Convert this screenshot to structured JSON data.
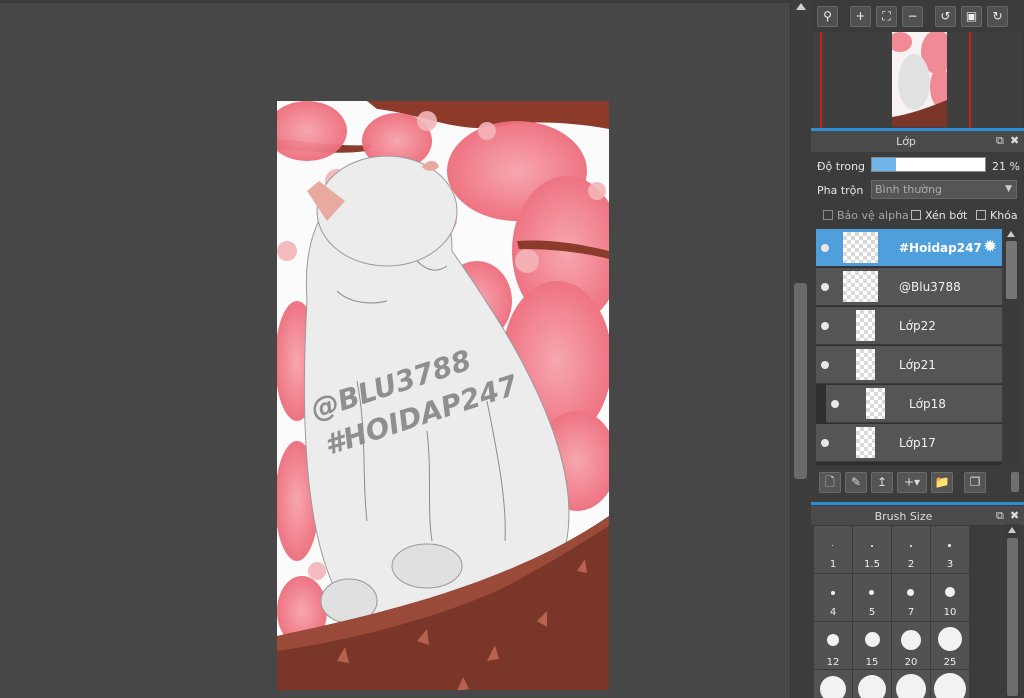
{
  "canvas": {
    "watermark_line1": "@BLU3788",
    "watermark_line2": "#HOIDAP247"
  },
  "navigator": {
    "toolbar_icons": [
      "zoom-icon",
      "zoom-in-icon",
      "fit-icon",
      "zoom-out-icon",
      "rotate-left-icon",
      "fullscreen-icon",
      "rotate-right-icon"
    ]
  },
  "layer_panel": {
    "title": "Lớp",
    "opacity_label": "Độ trong",
    "opacity_value": "21 %",
    "opacity_fraction": 0.21,
    "blend_label": "Pha trộn",
    "blend_value": "Bình thường",
    "options": {
      "protect_alpha": "Bảo vệ alpha",
      "clipping": "Xén bớt",
      "lock": "Khóa"
    },
    "layers": [
      {
        "name": "#Hoidap247",
        "selected": true
      },
      {
        "name": "@Blu3788",
        "selected": false
      },
      {
        "name": "Lớp22",
        "selected": false
      },
      {
        "name": "Lớp21",
        "selected": false
      },
      {
        "name": "Lớp18",
        "selected": false
      },
      {
        "name": "Lớp17",
        "selected": false
      }
    ]
  },
  "brush_panel": {
    "title": "Brush Size",
    "sizes": [
      "1",
      "1.5",
      "2",
      "3",
      "4",
      "5",
      "7",
      "10",
      "12",
      "15",
      "20",
      "25"
    ]
  },
  "colors": {
    "accent": "#2c8fd6",
    "selected_layer": "#4f9fdc",
    "opacity_fill": "#6fb4ea",
    "canvas_bg": "#474747"
  }
}
